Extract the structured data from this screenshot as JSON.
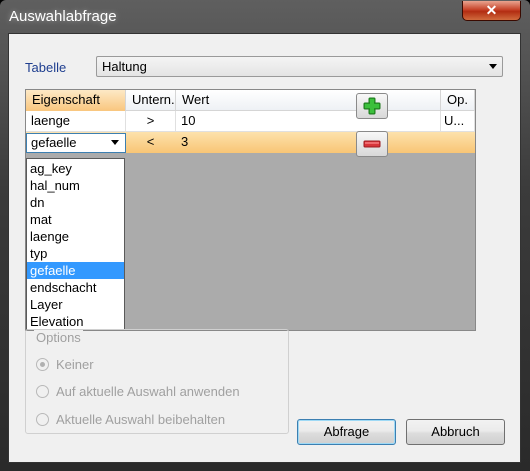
{
  "window": {
    "title": "Auswahlabfrage",
    "close_glyph": "✕"
  },
  "tabelle": {
    "label": "Tabelle",
    "value": "Haltung"
  },
  "grid": {
    "columns": [
      "Eigenschaft",
      "Untern.",
      "Wert",
      "Op."
    ],
    "rows": [
      {
        "eigenschaft": "laenge",
        "operator": ">",
        "wert": "10",
        "op": "U..."
      },
      {
        "eigenschaft": "gefaelle",
        "operator": "<",
        "wert": "3",
        "op": ""
      }
    ]
  },
  "dropdown": {
    "items": [
      "ag_key",
      "hal_num",
      "dn",
      "mat",
      "laenge",
      "typ",
      "gefaelle",
      "endschacht",
      "Layer",
      "Elevation"
    ],
    "selected_index": 6
  },
  "buttons": {
    "add_glyph": "+",
    "remove_glyph": "−",
    "abfrage": "Abfrage",
    "abbruch": "Abbruch"
  },
  "options": {
    "title": "Options",
    "choices": [
      "Keiner",
      "Auf aktuelle Auswahl anwenden",
      "Aktuelle Auswahl beibehalten"
    ],
    "selected_index": 0
  },
  "colors": {
    "accent_blue": "#3399ff",
    "row_highlight": "#f8c575",
    "add_green": "#2fa52f",
    "remove_red": "#d8353a"
  }
}
